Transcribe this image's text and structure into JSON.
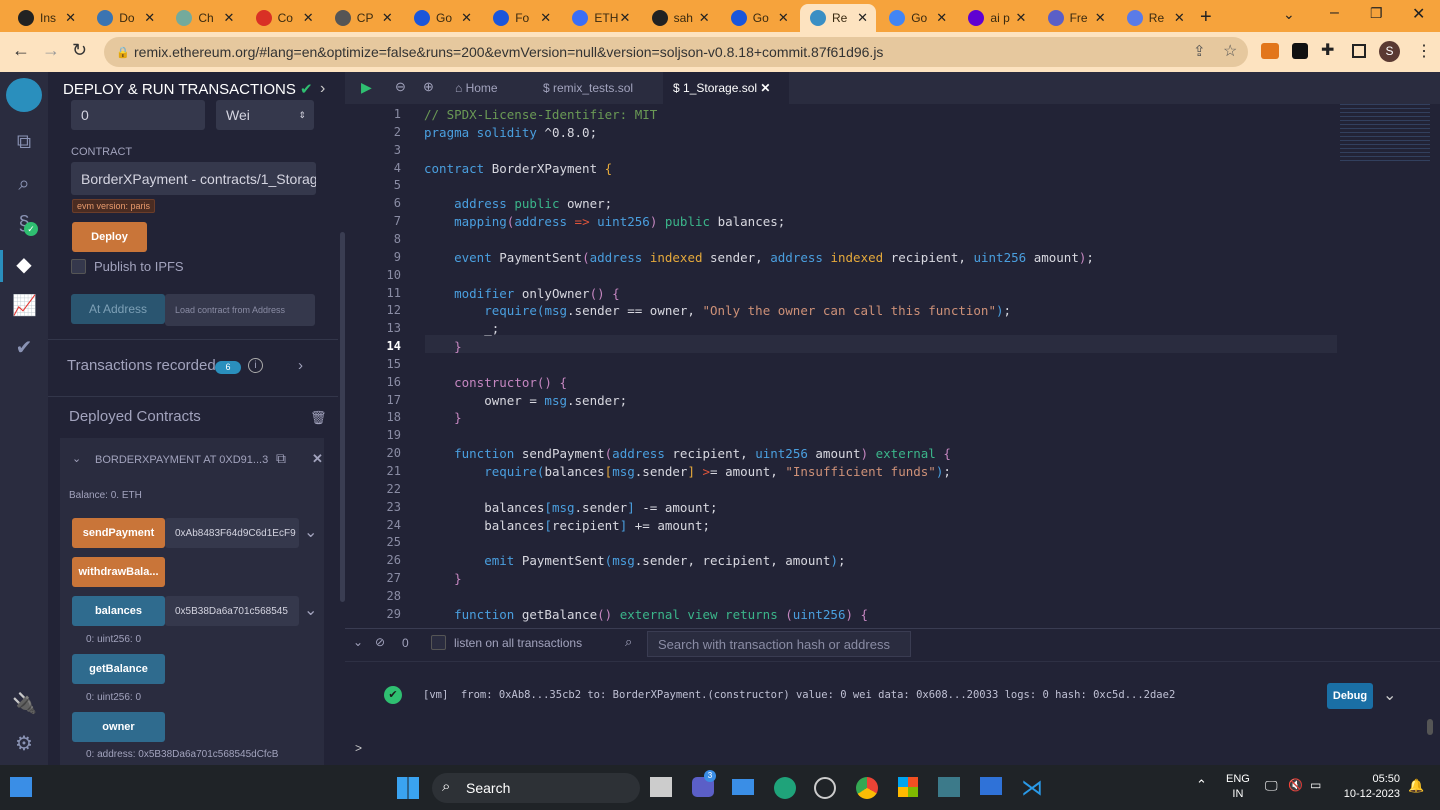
{
  "browser": {
    "tabs": [
      {
        "label": "Ins",
        "color": "#222"
      },
      {
        "label": "Do",
        "color": "#3b74b1"
      },
      {
        "label": "Ch",
        "color": "#74aa9c"
      },
      {
        "label": "Co",
        "color": "#d93025"
      },
      {
        "label": "CP",
        "color": "#555"
      },
      {
        "label": "Go",
        "color": "#1a56db"
      },
      {
        "label": "Fo",
        "color": "#1a56db"
      },
      {
        "label": "ETH",
        "color": "#3b6ef5"
      },
      {
        "label": "sah",
        "color": "#222"
      },
      {
        "label": "Go",
        "color": "#1a56db"
      },
      {
        "label": "Re",
        "color": "#3a8fc4",
        "active": true
      },
      {
        "label": "Go",
        "color": "#4285f4"
      },
      {
        "label": "ai p",
        "color": "#6001d2"
      },
      {
        "label": "Fre",
        "color": "#5b5fc7"
      },
      {
        "label": "Re",
        "color": "#5a7be8"
      }
    ],
    "new_tab": "+",
    "url": "remix.ethereum.org/#lang=en&optimize=false&runs=200&evmVersion=null&version=soljson-v0.8.18+commit.87f61d96.js",
    "profile": "S"
  },
  "side": {
    "title": "DEPLOY & RUN TRANSACTIONS",
    "value": "0",
    "unit": "Wei",
    "contract_label": "CONTRACT",
    "contract": "BorderXPayment - contracts/1_Storage.sol",
    "evm_badge": "evm version: paris",
    "deploy": "Deploy",
    "publish": "Publish to IPFS",
    "at_address": "At Address",
    "load_placeholder": "Load contract from Address",
    "tx_recorded": "Transactions recorded",
    "tx_count": "6",
    "deployed": "Deployed Contracts",
    "instance": "BORDERXPAYMENT AT 0XD91...3",
    "balance": "Balance: 0. ETH",
    "fns": {
      "send": "sendPayment",
      "send_val": "0xAb8483F64d9C6d1EcF9",
      "withdraw": "withdrawBala...",
      "balances": "balances",
      "balances_val": "0x5B38Da6a701c568545",
      "balances_out": "0: uint256: 0",
      "getBalance": "getBalance",
      "getBalance_out": "0: uint256: 0",
      "owner": "owner",
      "owner_out": "0:  address: 0x5B38Da6a701c568545dCfcB"
    }
  },
  "editor": {
    "home": "Home",
    "tab2": "remix_tests.sol",
    "tab3": "1_Storage.sol",
    "active_line": 14,
    "lines": [
      [
        [
          "t-com",
          "// SPDX-License-Identifier: MIT"
        ]
      ],
      [
        [
          "t-kw",
          "pragma solidity "
        ],
        [
          "t-tx",
          "^0.8.0;"
        ]
      ],
      [],
      [
        [
          "t-kw",
          "contract "
        ],
        [
          "t-tx",
          "BorderXPayment "
        ],
        [
          "t-idx",
          "{"
        ]
      ],
      [],
      [
        [
          "t-tx",
          "    "
        ],
        [
          "t-kw",
          "address "
        ],
        [
          "t-grn",
          "public "
        ],
        [
          "t-tx",
          "owner;"
        ]
      ],
      [
        [
          "t-tx",
          "    "
        ],
        [
          "t-kw",
          "mapping"
        ],
        [
          "t-pk",
          "("
        ],
        [
          "t-kw",
          "address "
        ],
        [
          "t-op",
          "=>"
        ],
        [
          "t-kw",
          " uint256"
        ],
        [
          "t-pk",
          ")"
        ],
        [
          "t-grn",
          " public "
        ],
        [
          "t-tx",
          "balances;"
        ]
      ],
      [],
      [
        [
          "t-tx",
          "    "
        ],
        [
          "t-kw",
          "event "
        ],
        [
          "t-tx",
          "PaymentSent"
        ],
        [
          "t-pk",
          "("
        ],
        [
          "t-kw",
          "address "
        ],
        [
          "t-idx",
          "indexed "
        ],
        [
          "t-tx",
          "sender, "
        ],
        [
          "t-kw",
          "address "
        ],
        [
          "t-idx",
          "indexed "
        ],
        [
          "t-tx",
          "recipient, "
        ],
        [
          "t-kw",
          "uint256 "
        ],
        [
          "t-tx",
          "amount"
        ],
        [
          "t-pk",
          ")"
        ],
        [
          "t-tx",
          ";"
        ]
      ],
      [],
      [
        [
          "t-tx",
          "    "
        ],
        [
          "t-kw",
          "modifier "
        ],
        [
          "t-tx",
          "onlyOwner"
        ],
        [
          "t-pk",
          "() {"
        ]
      ],
      [
        [
          "t-tx",
          "        "
        ],
        [
          "t-kw",
          "require"
        ],
        [
          "t-kw",
          "("
        ],
        [
          "t-kw",
          "msg"
        ],
        [
          "t-tx",
          ".sender == owner, "
        ],
        [
          "t-str",
          "\"Only the owner can call this function\""
        ],
        [
          "t-kw",
          ")"
        ],
        [
          "t-tx",
          ";"
        ]
      ],
      [
        [
          "t-tx",
          "        _;"
        ]
      ],
      [
        [
          "t-tx",
          "    "
        ],
        [
          "t-pk",
          "}"
        ]
      ],
      [],
      [
        [
          "t-tx",
          "    "
        ],
        [
          "t-pk",
          "constructor() {"
        ]
      ],
      [
        [
          "t-tx",
          "        owner = "
        ],
        [
          "t-kw",
          "msg"
        ],
        [
          "t-tx",
          ".sender;"
        ]
      ],
      [
        [
          "t-tx",
          "    "
        ],
        [
          "t-pk",
          "}"
        ]
      ],
      [],
      [
        [
          "t-tx",
          "    "
        ],
        [
          "t-kw",
          "function "
        ],
        [
          "t-tx",
          "sendPayment"
        ],
        [
          "t-pk",
          "("
        ],
        [
          "t-kw",
          "address "
        ],
        [
          "t-tx",
          "recipient, "
        ],
        [
          "t-kw",
          "uint256 "
        ],
        [
          "t-tx",
          "amount"
        ],
        [
          "t-pk",
          ")"
        ],
        [
          "t-grn",
          " external "
        ],
        [
          "t-pk",
          "{"
        ]
      ],
      [
        [
          "t-tx",
          "        "
        ],
        [
          "t-kw",
          "require("
        ],
        [
          "t-tx",
          "balances"
        ],
        [
          "t-idx",
          "["
        ],
        [
          "t-kw",
          "msg"
        ],
        [
          "t-tx",
          ".sender"
        ],
        [
          "t-idx",
          "]"
        ],
        [
          "t-op",
          " >"
        ],
        [
          "t-tx",
          "= amount, "
        ],
        [
          "t-str",
          "\"Insufficient funds\""
        ],
        [
          "t-kw",
          ")"
        ],
        [
          "t-tx",
          ";"
        ]
      ],
      [],
      [
        [
          "t-tx",
          "        balances"
        ],
        [
          "t-kw",
          "["
        ],
        [
          "t-kw",
          "msg"
        ],
        [
          "t-tx",
          ".sender"
        ],
        [
          "t-kw",
          "]"
        ],
        [
          "t-tx",
          " -= amount;"
        ]
      ],
      [
        [
          "t-tx",
          "        balances"
        ],
        [
          "t-kw",
          "["
        ],
        [
          "t-tx",
          "recipient"
        ],
        [
          "t-kw",
          "]"
        ],
        [
          "t-tx",
          " += amount;"
        ]
      ],
      [],
      [
        [
          "t-tx",
          "        "
        ],
        [
          "t-kw",
          "emit "
        ],
        [
          "t-tx",
          "PaymentSent"
        ],
        [
          "t-kw",
          "("
        ],
        [
          "t-kw",
          "msg"
        ],
        [
          "t-tx",
          ".sender, recipient, amount"
        ],
        [
          "t-kw",
          ")"
        ],
        [
          "t-tx",
          ";"
        ]
      ],
      [
        [
          "t-tx",
          "    "
        ],
        [
          "t-pk",
          "}"
        ]
      ],
      [],
      [
        [
          "t-tx",
          "    "
        ],
        [
          "t-kw",
          "function "
        ],
        [
          "t-tx",
          "getBalance"
        ],
        [
          "t-pk",
          "()"
        ],
        [
          "t-grn",
          " external view returns "
        ],
        [
          "t-pk",
          "("
        ],
        [
          "t-kw",
          "uint256"
        ],
        [
          "t-pk",
          ") {"
        ]
      ]
    ]
  },
  "terminal": {
    "count": "0",
    "listen": "listen on all transactions",
    "search_placeholder": "Search with transaction hash or address",
    "log": "[vm]  from: 0xAb8...35cb2 to: BorderXPayment.(constructor) value: 0 wei data: 0x608...20033 logs: 0 hash: 0xc5d...2dae2",
    "debug": "Debug",
    "prompt": ">"
  },
  "taskbar": {
    "search": "Search",
    "lang1": "ENG",
    "lang2": "IN",
    "time": "05:50",
    "date": "10-12-2023",
    "badge": "3"
  }
}
